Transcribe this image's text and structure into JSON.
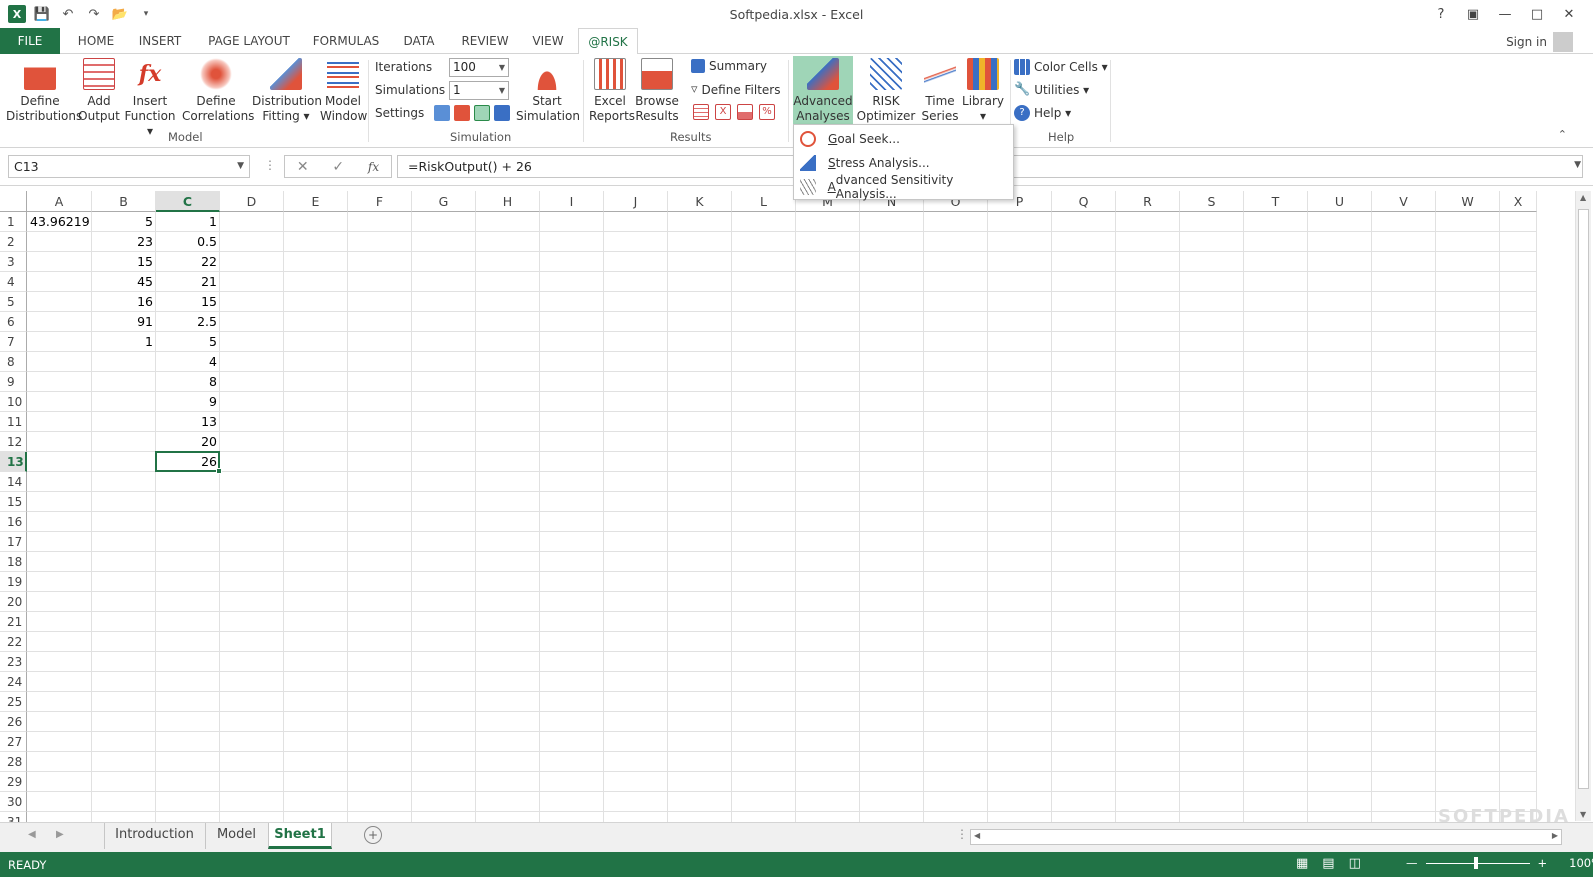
{
  "window": {
    "title": "Softpedia.xlsx - Excel",
    "help": "?",
    "sign_in": "Sign in"
  },
  "ribbon_tabs": [
    "FILE",
    "HOME",
    "INSERT",
    "PAGE LAYOUT",
    "FORMULAS",
    "DATA",
    "REVIEW",
    "VIEW",
    "@RISK"
  ],
  "active_tab": "@RISK",
  "model_group": {
    "label": "Model",
    "buttons": [
      {
        "l1": "Define",
        "l2": "Distributions"
      },
      {
        "l1": "Add",
        "l2": "Output"
      },
      {
        "l1": "Insert",
        "l2": "Function ▾"
      },
      {
        "l1": "Define",
        "l2": "Correlations"
      },
      {
        "l1": "Distribution",
        "l2": "Fitting ▾"
      },
      {
        "l1": "Model",
        "l2": "Window"
      }
    ]
  },
  "simulation_group": {
    "label": "Simulation",
    "iterations_label": "Iterations",
    "iterations_value": "100",
    "simulations_label": "Simulations",
    "simulations_value": "1",
    "settings_label": "Settings",
    "start_l1": "Start",
    "start_l2": "Simulation"
  },
  "results_group": {
    "label": "Results",
    "excel_l1": "Excel",
    "excel_l2": "Reports",
    "browse_l1": "Browse",
    "browse_l2": "Results",
    "summary": "Summary",
    "define_filters": "Define Filters"
  },
  "tools_group": {
    "advanced_l1": "Advanced",
    "advanced_l2": "Analyses ▾",
    "optimizer_l1": "RISK",
    "optimizer_l2": "Optimizer ▾",
    "time_l1": "Time",
    "time_l2": "Series ▾",
    "library_l1": "Library",
    "library_l2": "▾"
  },
  "help_group": {
    "label": "Help",
    "color_cells": "Color Cells ▾",
    "utilities": "Utilities ▾",
    "help": "Help ▾"
  },
  "dropdown": [
    {
      "pre": "",
      "u": "G",
      "post": "oal Seek..."
    },
    {
      "pre": "",
      "u": "S",
      "post": "tress Analysis..."
    },
    {
      "pre": "",
      "u": "A",
      "post": "dvanced Sensitivity Analysis..."
    }
  ],
  "formula_bar": {
    "name_box": "C13",
    "formula": "=RiskOutput() + 26",
    "fx": "fx"
  },
  "columns": [
    "A",
    "B",
    "C",
    "D",
    "E",
    "F",
    "G",
    "H",
    "I",
    "J",
    "K",
    "L",
    "M",
    "N",
    "O",
    "P",
    "Q",
    "R",
    "S",
    "T",
    "U",
    "V",
    "W",
    "X"
  ],
  "rows": [
    "1",
    "2",
    "3",
    "4",
    "5",
    "6",
    "7",
    "8",
    "9",
    "10",
    "11",
    "12",
    "13",
    "14",
    "15",
    "16",
    "17",
    "18",
    "19",
    "20",
    "21",
    "22",
    "23",
    "24",
    "25",
    "26",
    "27",
    "28",
    "29",
    "30",
    "31"
  ],
  "cells": {
    "A1": "43.96219",
    "B": [
      "5",
      "23",
      "15",
      "45",
      "16",
      "91",
      "1"
    ],
    "C": [
      "1",
      "0.5",
      "22",
      "21",
      "15",
      "2.5",
      "5",
      "4",
      "8",
      "9",
      "13",
      "20",
      "26"
    ]
  },
  "sheet_tabs": [
    "Introduction",
    "Model",
    "Sheet1"
  ],
  "active_sheet": "Sheet1",
  "status": {
    "ready": "READY",
    "zoom": "100%"
  },
  "watermark": "SOFTPEDIA",
  "colors": {
    "excel_green": "#217346",
    "highlight": "#9fd5b7"
  }
}
